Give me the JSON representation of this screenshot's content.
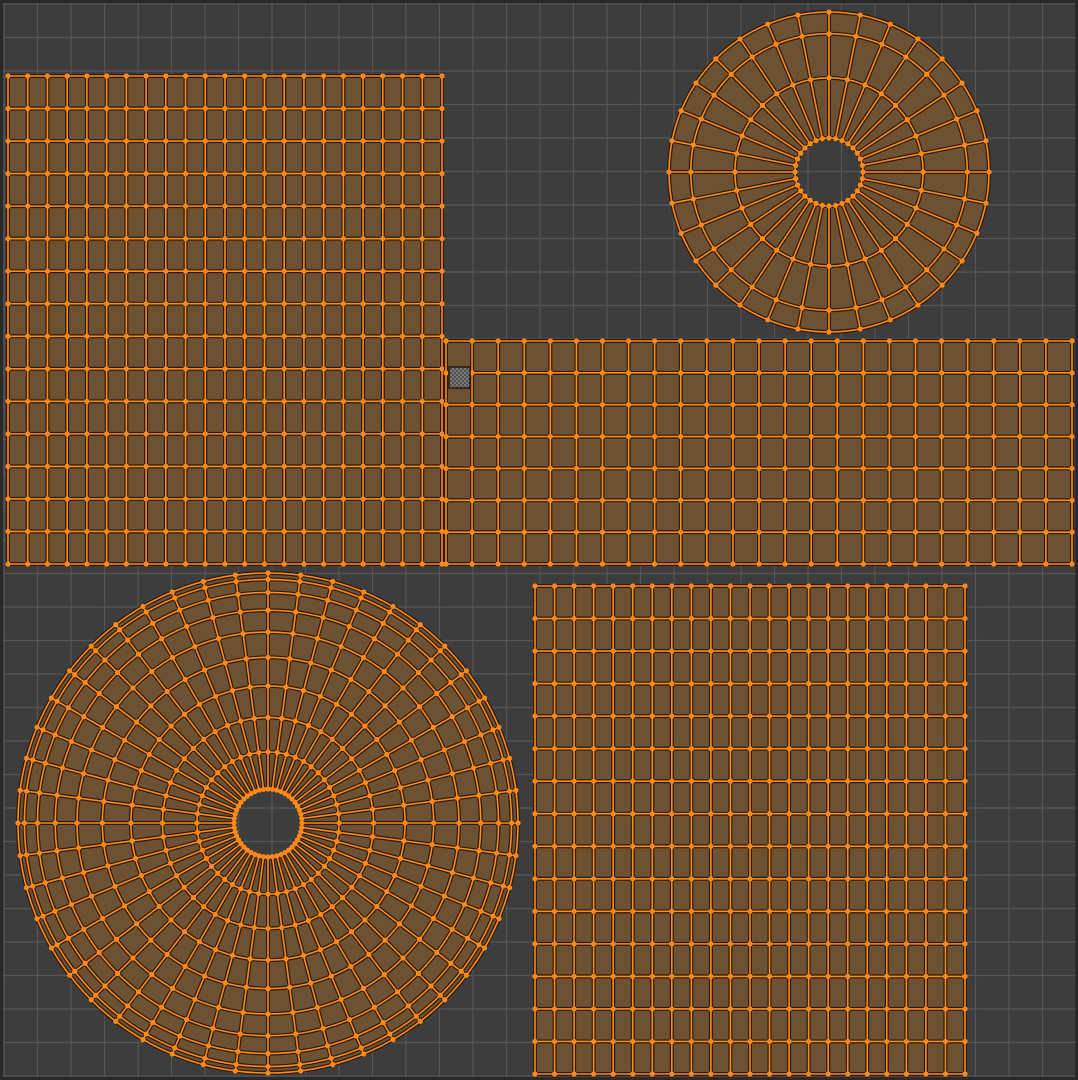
{
  "editor": {
    "type": "uv-editor",
    "mode": "uv-edit",
    "select_mode": "vertex",
    "all_selected": true
  },
  "colors": {
    "background": "#3d3d3d",
    "grid_line": "#555555",
    "grid_border": "#2a2a2a",
    "island_fill": "#6f5233",
    "edge_dark": "#2a1a0c",
    "edge_selected": "#ff8a1a",
    "vertex_selected": "#ff8a1a",
    "checker_light": "#7a7a7a",
    "checker_dark": "#505050"
  },
  "islands": [
    {
      "name": "uv-island-rect-top-left",
      "shape": "grid",
      "cols": 22,
      "rows": 15
    },
    {
      "name": "uv-island-disc-top-right",
      "shape": "ring",
      "segments": 32,
      "rings": 3
    },
    {
      "name": "uv-island-strip-middle-right",
      "shape": "grid",
      "cols": 24,
      "rows": 7
    },
    {
      "name": "uv-island-disc-bottom-left",
      "shape": "ring",
      "segments": 48,
      "rings": 9
    },
    {
      "name": "uv-island-rect-bottom-right",
      "shape": "grid",
      "cols": 22,
      "rows": 15
    }
  ],
  "selected_face_marker": {
    "name": "active-face-marker",
    "pattern": "checker"
  }
}
